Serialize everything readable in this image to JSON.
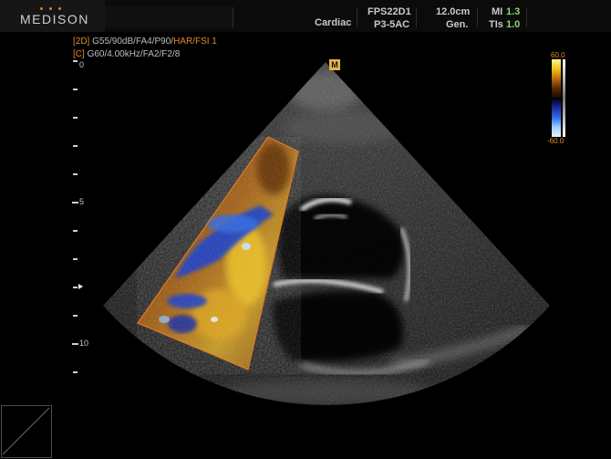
{
  "header": {
    "brand": "MEDISON",
    "application": "Cardiac",
    "frame_rate": "FPS22D1",
    "probe": "P3-5AC",
    "depth": "12.0cm",
    "preset": "Gen.",
    "mi_label": "MI",
    "mi_value": "1.3",
    "tis_label": "TIs",
    "tis_value": "1.0"
  },
  "params": {
    "line1_tag": "[2D]",
    "line1_text": "G55/90dB/FA4/P90/",
    "line1_hl": "HAR/FSI 1",
    "line2_tag": "[C]",
    "line2_text": "G60/4.00kHz/FA2/F2/8"
  },
  "depth_scale": {
    "labels": [
      "0",
      "5",
      "10"
    ]
  },
  "color_bar": {
    "top_value": "60.0",
    "bottom_value": "-60.0"
  },
  "marker": "M",
  "colors": {
    "accent": "#e08a2a",
    "green": "#8fd36b",
    "roi_outline": "#e07a20"
  }
}
